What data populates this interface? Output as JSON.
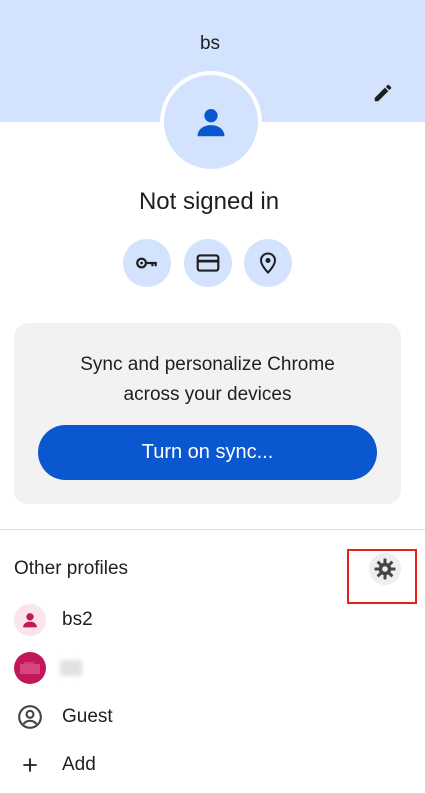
{
  "header": {
    "profile_name": "bs",
    "background_color": "#d3e3fd",
    "edit_icon": "pencil-icon",
    "avatar_icon": "person-icon"
  },
  "status": {
    "text": "Not signed in"
  },
  "quick_actions": [
    {
      "name": "passwords",
      "icon": "key-icon"
    },
    {
      "name": "payment-methods",
      "icon": "credit-card-icon"
    },
    {
      "name": "addresses",
      "icon": "location-pin-icon"
    }
  ],
  "sync_card": {
    "line1": "Sync and personalize Chrome",
    "line2": "across your devices",
    "button_label": "Turn on sync...",
    "button_color": "#0b57d0"
  },
  "other_profiles": {
    "title": "Other profiles",
    "settings_icon": "gear-icon",
    "items": [
      {
        "label": "bs2",
        "icon": "person-icon",
        "color": "#c2185b"
      },
      {
        "label": "",
        "icon": "profile-photo",
        "color": "#c2185b"
      },
      {
        "label": "Guest",
        "icon": "guest-account-icon"
      },
      {
        "label": "Add",
        "icon": "plus-icon"
      }
    ]
  },
  "highlight_color": "#e8201a"
}
